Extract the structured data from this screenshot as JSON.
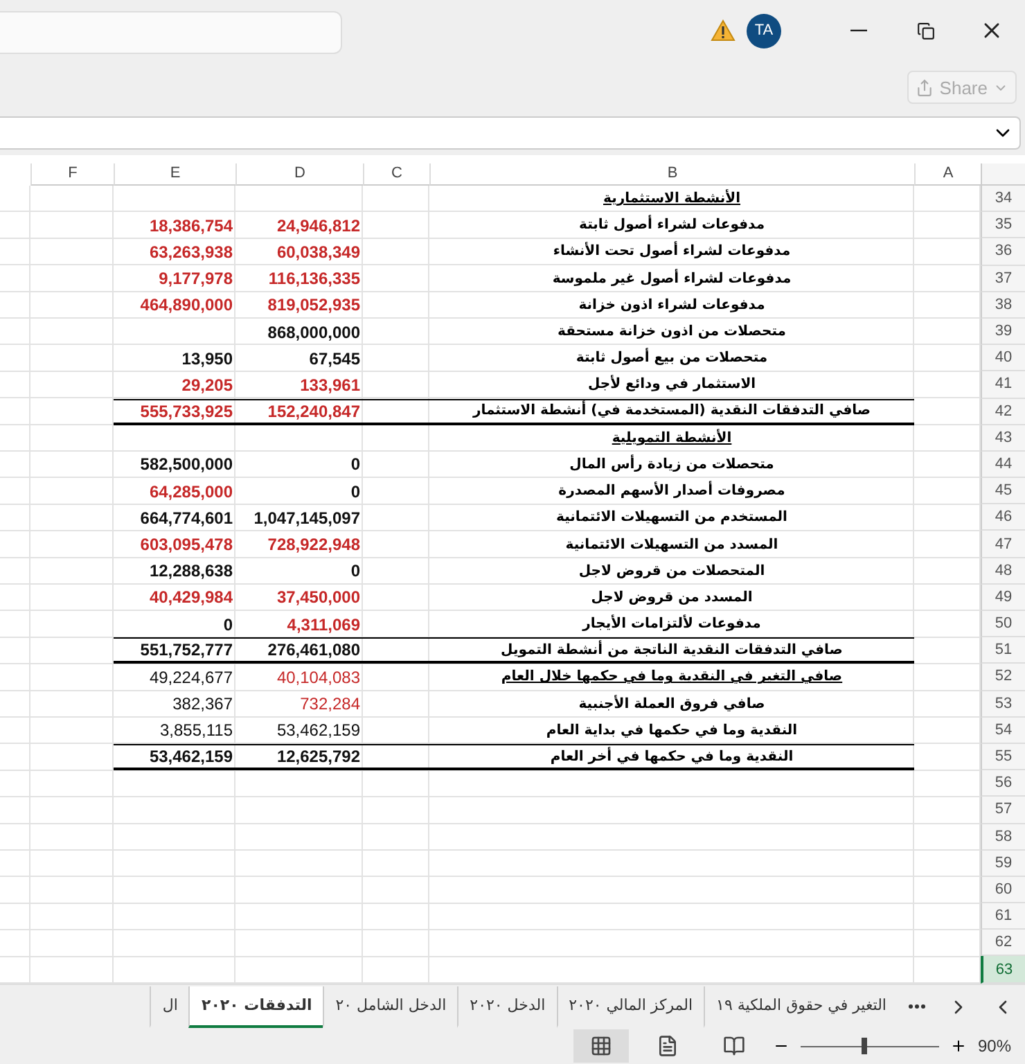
{
  "title_bar": {
    "avatar": "TA",
    "has_warning": true
  },
  "share": {
    "label": "Share",
    "disabled": true
  },
  "columns": [
    "A",
    "B",
    "C",
    "D",
    "E",
    "F"
  ],
  "rows": [
    {
      "number": "34",
      "label": "الأنشطة الاستثمارية",
      "underline": true,
      "rule_above": false,
      "rule_below": false,
      "selected": false
    },
    {
      "number": "35",
      "label": "مدفوعات لشراء أصول ثابتة",
      "underline": false,
      "bold": true,
      "rule_above": false,
      "rule_below": false,
      "selected": false,
      "d": {
        "text": "24,946,812",
        "negative": true
      },
      "e": {
        "text": "18,386,754",
        "negative": true
      }
    },
    {
      "number": "36",
      "label": "مدفوعات لشراء أصول تحت الأنشاء",
      "underline": false,
      "bold": true,
      "rule_above": false,
      "rule_below": false,
      "selected": false,
      "d": {
        "text": "60,038,349",
        "negative": true
      },
      "e": {
        "text": "63,263,938",
        "negative": true
      }
    },
    {
      "number": "37",
      "label": "مدفوعات لشراء أصول غير ملموسة",
      "underline": false,
      "bold": true,
      "rule_above": false,
      "rule_below": false,
      "selected": false,
      "d": {
        "text": "116,136,335",
        "negative": true
      },
      "e": {
        "text": "9,177,978",
        "negative": true
      }
    },
    {
      "number": "38",
      "label": "مدفوعات لشراء اذون خزانة",
      "underline": false,
      "bold": true,
      "rule_above": false,
      "rule_below": false,
      "selected": false,
      "d": {
        "text": "819,052,935",
        "negative": true
      },
      "e": {
        "text": "464,890,000",
        "negative": true
      }
    },
    {
      "number": "39",
      "label": "متحصلات من اذون خزانة مستحقة",
      "underline": false,
      "bold": true,
      "rule_above": false,
      "rule_below": false,
      "selected": false,
      "d": {
        "text": "868,000,000",
        "negative": false
      }
    },
    {
      "number": "40",
      "label": "متحصلات من بيع أصول ثابتة",
      "underline": false,
      "bold": true,
      "rule_above": false,
      "rule_below": false,
      "selected": false,
      "d": {
        "text": "67,545",
        "negative": false
      },
      "e": {
        "text": "13,950",
        "negative": false
      }
    },
    {
      "number": "41",
      "label": "الاستثمار في ودائع لأجل",
      "underline": false,
      "bold": true,
      "rule_above": false,
      "rule_below": false,
      "selected": false,
      "d": {
        "text": "133,961",
        "negative": true
      },
      "e": {
        "text": "29,205",
        "negative": true
      }
    },
    {
      "number": "42",
      "label": "صافي التدفقات النقدية (المستخدمة في) أنشطة الاستثمار",
      "underline": false,
      "bold": true,
      "rule_above": true,
      "rule_below": true,
      "selected": false,
      "d": {
        "text": "152,240,847",
        "negative": true
      },
      "e": {
        "text": "555,733,925",
        "negative": true
      }
    },
    {
      "number": "43",
      "label": "الأنشطة التمويلية",
      "underline": true,
      "rule_above": false,
      "rule_below": false,
      "selected": false
    },
    {
      "number": "44",
      "label": "متحصلات من زيادة رأس المال",
      "underline": false,
      "bold": true,
      "rule_above": false,
      "rule_below": false,
      "selected": false,
      "d": {
        "text": "0",
        "negative": false
      },
      "e": {
        "text": "582,500,000",
        "negative": false
      }
    },
    {
      "number": "45",
      "label": "مصروفات أصدار الأسهم المصدرة",
      "underline": false,
      "bold": true,
      "rule_above": false,
      "rule_below": false,
      "selected": false,
      "d": {
        "text": "0",
        "negative": false
      },
      "e": {
        "text": "64,285,000",
        "negative": true
      }
    },
    {
      "number": "46",
      "label": "المستخدم من التسهيلات الائتمانية",
      "underline": false,
      "bold": true,
      "rule_above": false,
      "rule_below": false,
      "selected": false,
      "d": {
        "text": "1,047,145,097",
        "negative": false
      },
      "e": {
        "text": "664,774,601",
        "negative": false
      }
    },
    {
      "number": "47",
      "label": "المسدد من التسهيلات الائتمانية",
      "underline": false,
      "bold": true,
      "rule_above": false,
      "rule_below": false,
      "selected": false,
      "d": {
        "text": "728,922,948",
        "negative": true
      },
      "e": {
        "text": "603,095,478",
        "negative": true
      }
    },
    {
      "number": "48",
      "label": "المتحصلات من قروض لاجل",
      "underline": false,
      "bold": true,
      "rule_above": false,
      "rule_below": false,
      "selected": false,
      "d": {
        "text": "0",
        "negative": false
      },
      "e": {
        "text": "12,288,638",
        "negative": false
      }
    },
    {
      "number": "49",
      "label": "المسدد من قروض لاجل",
      "underline": false,
      "bold": true,
      "rule_above": false,
      "rule_below": false,
      "selected": false,
      "d": {
        "text": "37,450,000",
        "negative": true
      },
      "e": {
        "text": "40,429,984",
        "negative": true
      }
    },
    {
      "number": "50",
      "label": "مدفوعات لألتزامات الأيجار",
      "underline": false,
      "bold": true,
      "rule_above": false,
      "rule_below": false,
      "selected": false,
      "d": {
        "text": "4,311,069",
        "negative": true
      },
      "e": {
        "text": "0",
        "negative": false
      }
    },
    {
      "number": "51",
      "label": "صافي التدفقات النقدية الناتجة من أنشطة التمويل",
      "underline": false,
      "bold": true,
      "rule_above": true,
      "rule_below": true,
      "selected": false,
      "d": {
        "text": "276,461,080",
        "negative": false
      },
      "e": {
        "text": "551,752,777",
        "negative": false
      }
    },
    {
      "number": "52",
      "label": "صافي التغير في النقدية وما في حكمها خلال العام",
      "underline": true,
      "bold": false,
      "rule_above": false,
      "rule_below": false,
      "selected": false,
      "d": {
        "text": "40,104,083",
        "negative": true
      },
      "e": {
        "text": "49,224,677",
        "negative": false
      }
    },
    {
      "number": "53",
      "label": "صافي فروق العملة الأجنبية",
      "underline": false,
      "bold": false,
      "rule_above": false,
      "rule_below": false,
      "selected": false,
      "d": {
        "text": "732,284",
        "negative": true
      },
      "e": {
        "text": "382,367",
        "negative": false
      }
    },
    {
      "number": "54",
      "label": "النقدية وما في حكمها في بداية العام",
      "underline": false,
      "bold": false,
      "rule_above": false,
      "rule_below": false,
      "selected": false,
      "d": {
        "text": "53,462,159",
        "negative": false
      },
      "e": {
        "text": "3,855,115",
        "negative": false
      }
    },
    {
      "number": "55",
      "label": "النقدية وما في حكمها في أخر العام",
      "underline": false,
      "bold": true,
      "rule_above": true,
      "rule_below": true,
      "selected": false,
      "d": {
        "text": "12,625,792",
        "negative": false
      },
      "e": {
        "text": "53,462,159",
        "negative": false
      }
    },
    {
      "number": "56",
      "selected": false
    },
    {
      "number": "57",
      "selected": false
    },
    {
      "number": "58",
      "selected": false
    },
    {
      "number": "59",
      "selected": false
    },
    {
      "number": "60",
      "selected": false
    },
    {
      "number": "61",
      "selected": false
    },
    {
      "number": "62",
      "selected": false
    },
    {
      "number": "63",
      "selected": true
    }
  ],
  "sheet_tabs": [
    {
      "label": "التغير في حقوق الملكية ١٩",
      "selected": false
    },
    {
      "label": "المركز المالي ٢٠٢٠",
      "selected": false
    },
    {
      "label": "الدخل ٢٠٢٠",
      "selected": false
    },
    {
      "label": "الدخل الشامل ٢٠",
      "selected": false
    },
    {
      "label": "التدفقات ٢٠٢٠",
      "selected": true
    },
    {
      "label": "ال",
      "selected": false
    }
  ],
  "status_bar": {
    "views": [
      {
        "kind": "normal",
        "selected": true
      },
      {
        "kind": "page_layout",
        "selected": false
      },
      {
        "kind": "page_break",
        "selected": false
      }
    ],
    "zoom": {
      "level": 0.46,
      "reading": "90%"
    }
  }
}
